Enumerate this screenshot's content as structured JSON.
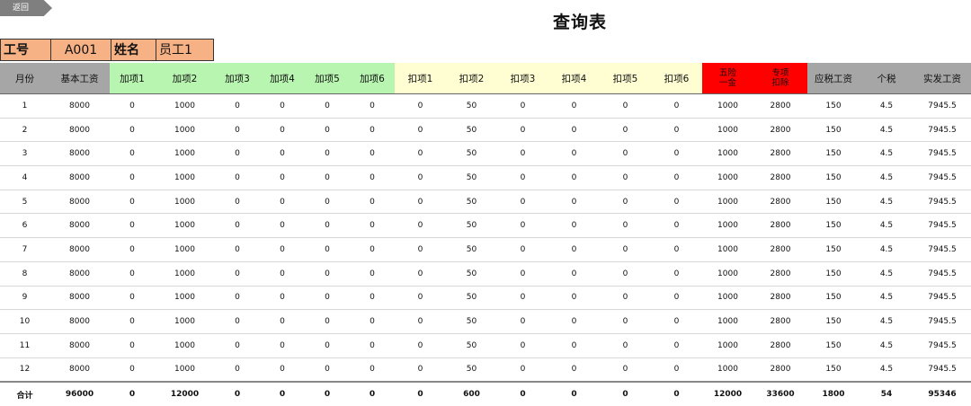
{
  "back_label": "返回",
  "title": "查询表",
  "info": {
    "id_label": "工号",
    "id_value": "A001",
    "name_label": "姓名",
    "name_value": "员工1"
  },
  "columns": [
    {
      "label": "月份",
      "cls": "gray"
    },
    {
      "label": "基本工资",
      "cls": "gray"
    },
    {
      "label": "加项1",
      "cls": "green"
    },
    {
      "label": "加项2",
      "cls": "green"
    },
    {
      "label": "加项3",
      "cls": "green"
    },
    {
      "label": "加项4",
      "cls": "green"
    },
    {
      "label": "加项5",
      "cls": "green"
    },
    {
      "label": "加项6",
      "cls": "green"
    },
    {
      "label": "扣项1",
      "cls": "yellow"
    },
    {
      "label": "扣项2",
      "cls": "yellow"
    },
    {
      "label": "扣项3",
      "cls": "yellow"
    },
    {
      "label": "扣项4",
      "cls": "yellow"
    },
    {
      "label": "扣项5",
      "cls": "yellow"
    },
    {
      "label": "扣项6",
      "cls": "yellow"
    },
    {
      "label": "五险\n一金",
      "cls": "red"
    },
    {
      "label": "专项\n扣除",
      "cls": "red"
    },
    {
      "label": "应税工资",
      "cls": "dgray"
    },
    {
      "label": "个税",
      "cls": "dgray"
    },
    {
      "label": "实发工资",
      "cls": "dgray"
    }
  ],
  "rows": [
    [
      "1",
      "8000",
      "0",
      "1000",
      "0",
      "0",
      "0",
      "0",
      "0",
      "50",
      "0",
      "0",
      "0",
      "0",
      "1000",
      "2800",
      "150",
      "4.5",
      "7945.5"
    ],
    [
      "2",
      "8000",
      "0",
      "1000",
      "0",
      "0",
      "0",
      "0",
      "0",
      "50",
      "0",
      "0",
      "0",
      "0",
      "1000",
      "2800",
      "150",
      "4.5",
      "7945.5"
    ],
    [
      "3",
      "8000",
      "0",
      "1000",
      "0",
      "0",
      "0",
      "0",
      "0",
      "50",
      "0",
      "0",
      "0",
      "0",
      "1000",
      "2800",
      "150",
      "4.5",
      "7945.5"
    ],
    [
      "4",
      "8000",
      "0",
      "1000",
      "0",
      "0",
      "0",
      "0",
      "0",
      "50",
      "0",
      "0",
      "0",
      "0",
      "1000",
      "2800",
      "150",
      "4.5",
      "7945.5"
    ],
    [
      "5",
      "8000",
      "0",
      "1000",
      "0",
      "0",
      "0",
      "0",
      "0",
      "50",
      "0",
      "0",
      "0",
      "0",
      "1000",
      "2800",
      "150",
      "4.5",
      "7945.5"
    ],
    [
      "6",
      "8000",
      "0",
      "1000",
      "0",
      "0",
      "0",
      "0",
      "0",
      "50",
      "0",
      "0",
      "0",
      "0",
      "1000",
      "2800",
      "150",
      "4.5",
      "7945.5"
    ],
    [
      "7",
      "8000",
      "0",
      "1000",
      "0",
      "0",
      "0",
      "0",
      "0",
      "50",
      "0",
      "0",
      "0",
      "0",
      "1000",
      "2800",
      "150",
      "4.5",
      "7945.5"
    ],
    [
      "8",
      "8000",
      "0",
      "1000",
      "0",
      "0",
      "0",
      "0",
      "0",
      "50",
      "0",
      "0",
      "0",
      "0",
      "1000",
      "2800",
      "150",
      "4.5",
      "7945.5"
    ],
    [
      "9",
      "8000",
      "0",
      "1000",
      "0",
      "0",
      "0",
      "0",
      "0",
      "50",
      "0",
      "0",
      "0",
      "0",
      "1000",
      "2800",
      "150",
      "4.5",
      "7945.5"
    ],
    [
      "10",
      "8000",
      "0",
      "1000",
      "0",
      "0",
      "0",
      "0",
      "0",
      "50",
      "0",
      "0",
      "0",
      "0",
      "1000",
      "2800",
      "150",
      "4.5",
      "7945.5"
    ],
    [
      "11",
      "8000",
      "0",
      "1000",
      "0",
      "0",
      "0",
      "0",
      "0",
      "50",
      "0",
      "0",
      "0",
      "0",
      "1000",
      "2800",
      "150",
      "4.5",
      "7945.5"
    ],
    [
      "12",
      "8000",
      "0",
      "1000",
      "0",
      "0",
      "0",
      "0",
      "0",
      "50",
      "0",
      "0",
      "0",
      "0",
      "1000",
      "2800",
      "150",
      "4.5",
      "7945.5"
    ]
  ],
  "total": [
    "合计",
    "96000",
    "0",
    "12000",
    "0",
    "0",
    "0",
    "0",
    "0",
    "600",
    "0",
    "0",
    "0",
    "0",
    "12000",
    "33600",
    "1800",
    "54",
    "95346"
  ]
}
